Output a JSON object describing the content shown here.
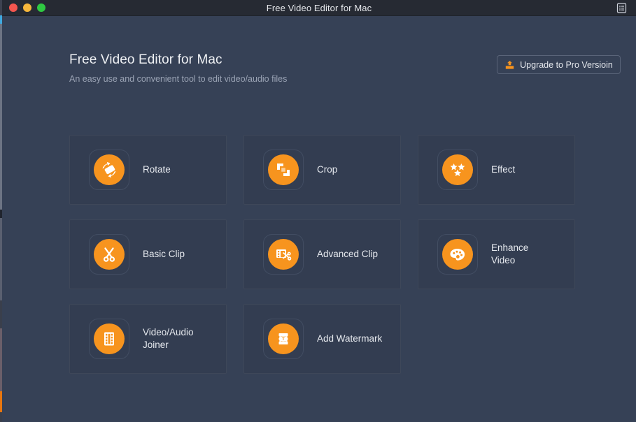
{
  "window": {
    "title": "Free Video Editor for Mac",
    "traffic_lights": [
      "close",
      "minimize",
      "zoom"
    ],
    "menu_icon": "list-menu-icon"
  },
  "header": {
    "title": "Free Video Editor for Mac",
    "subtitle": "An easy use and convenient tool to edit video/audio files"
  },
  "upgrade": {
    "label": "Upgrade to Pro Versioin",
    "icon": "upload-box-icon"
  },
  "colors": {
    "window_background": "#364156",
    "title_bar": "#262a33",
    "card_background": "#333d51",
    "card_border": "#3e4759",
    "accent_orange": "#f7941e",
    "primary_text": "#e6e9ee",
    "secondary_text": "#9aa3b4"
  },
  "cards": [
    {
      "label": "Rotate",
      "icon": "rotate-icon"
    },
    {
      "label": "Crop",
      "icon": "crop-icon"
    },
    {
      "label": "Effect",
      "icon": "stars-effect-icon"
    },
    {
      "label": "Basic Clip",
      "icon": "scissors-icon"
    },
    {
      "label": "Advanced Clip",
      "icon": "film-scissors-icon"
    },
    {
      "label": "Enhance\nVideo",
      "icon": "palette-icon"
    },
    {
      "label": "Video/Audio\nJoiner",
      "icon": "film-strip-icon"
    },
    {
      "label": "Add Watermark",
      "icon": "watermark-text-icon"
    }
  ]
}
